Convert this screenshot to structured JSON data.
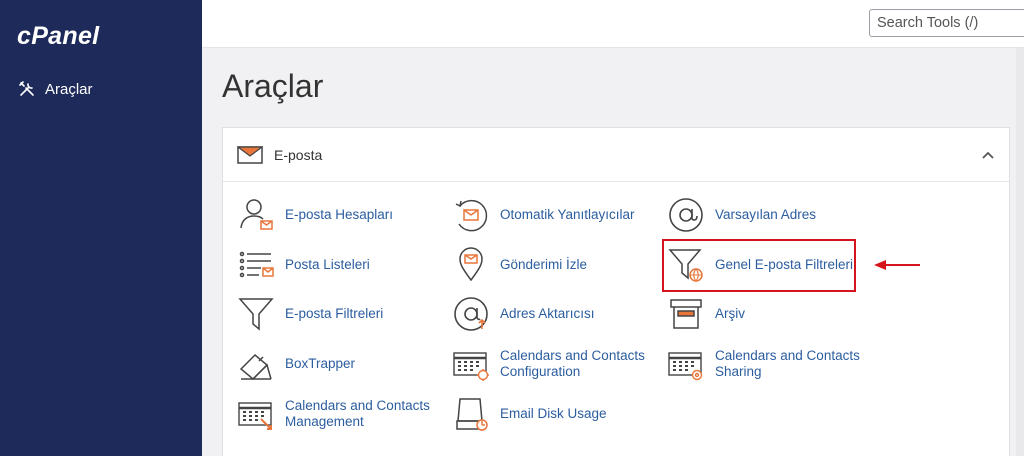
{
  "sidebar": {
    "logo": "cPanel",
    "nav": [
      {
        "label": "Araçlar",
        "icon": "tools-icon"
      }
    ]
  },
  "topbar": {
    "search_placeholder": "Search Tools (/)"
  },
  "page": {
    "title": "Araçlar"
  },
  "email_section": {
    "title": "E-posta",
    "icon": "envelope-icon",
    "tools": [
      {
        "lines": [
          "E-posta Hesapları"
        ],
        "icon": "email-accounts-icon"
      },
      {
        "lines": [
          "Otomatik Yanıtlayıcılar"
        ],
        "icon": "autoresponder-icon"
      },
      {
        "lines": [
          "Varsayılan Adres"
        ],
        "icon": "at-sign-icon"
      },
      {
        "lines": [
          "Posta Listeleri"
        ],
        "icon": "mailing-list-icon"
      },
      {
        "lines": [
          "Gönderimi İzle"
        ],
        "icon": "location-pin-icon"
      },
      {
        "lines": [
          "Genel E-posta Filtreleri"
        ],
        "icon": "global-filter-icon"
      },
      {
        "lines": [
          "E-posta Filtreleri"
        ],
        "icon": "filter-icon"
      },
      {
        "lines": [
          "Adres Aktarıcısı"
        ],
        "icon": "forwarder-icon"
      },
      {
        "lines": [
          "Arşiv"
        ],
        "icon": "archive-box-icon"
      },
      {
        "lines": [
          "BoxTrapper"
        ],
        "icon": "boxtrapper-icon"
      },
      {
        "lines": [
          "Calendars and Contacts",
          "Configuration"
        ],
        "icon": "calendar-config-icon"
      },
      {
        "lines": [
          "Calendars and Contacts",
          "Sharing"
        ],
        "icon": "calendar-sharing-icon"
      },
      {
        "lines": [
          "Calendars and Contacts",
          "Management"
        ],
        "icon": "calendar-management-icon"
      },
      {
        "lines": [
          "Email Disk Usage"
        ],
        "icon": "disk-usage-icon"
      }
    ]
  },
  "colors": {
    "sidebar": "#1e2a5a",
    "link": "#2b5d9f",
    "accent": "#e8763a",
    "highlight": "#d6141c"
  }
}
